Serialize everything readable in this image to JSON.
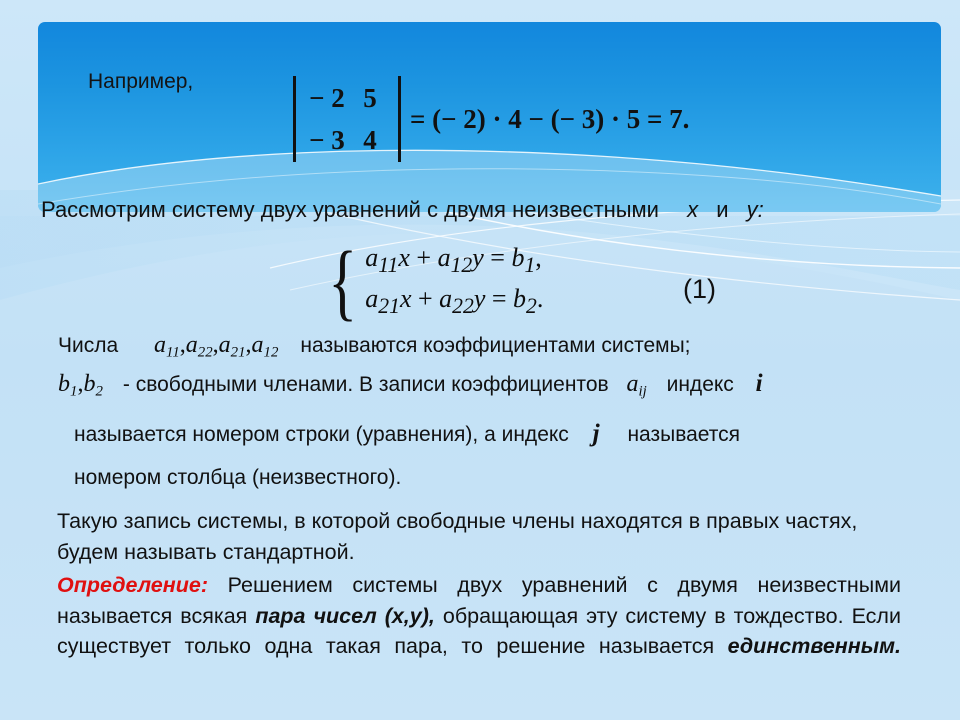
{
  "slide": {
    "background_color": "#c6e3f7",
    "panel_color": "#1d95e0",
    "accent_red": "#e01010"
  },
  "panel": {
    "label": "Например,",
    "determinant": {
      "matrix": [
        [
          "− 2",
          "5"
        ],
        [
          "− 3",
          "4"
        ]
      ],
      "rhs": "= (− 2) · 4 − (− 3) · 5 = 7."
    }
  },
  "body": {
    "consider_prefix": "Рассмотрим систему двух уравнений с  двумя неизвестными",
    "consider_x": "x",
    "consider_and": "и",
    "consider_y": "y:",
    "system": {
      "equation_1": {
        "a1": "a",
        "a1_sub": "11",
        "x": "x",
        "plus": "+",
        "a2": "a",
        "a2_sub": "12",
        "y": "y",
        "eq": "=",
        "b": "b",
        "b_sub": "1",
        "tail": ","
      },
      "equation_2": {
        "a1": "a",
        "a1_sub": "21",
        "x": "x",
        "plus": "+",
        "a2": "a",
        "a2_sub": "22",
        "y": "y",
        "eq": "=",
        "b": "b",
        "b_sub": "2",
        "tail": "."
      }
    },
    "equation_number": "(1)",
    "chisla_prefix": "Числа",
    "coefficients": "a₁₁ , a₂₂ , a₂₁ , a₁₂",
    "chisla_suffix": "называются коэффициентами системы;",
    "free_terms_symbols": "b₁ , b₂",
    "free_terms_text": "- свободными членами. В записи коэффициентов",
    "aij": "aᵢⱼ",
    "index_word": "индекс",
    "index_i": "i",
    "row_line": "называется номером строки (уравнения), а индекс",
    "index_j": "j",
    "row_line_tail": "называется",
    "column_line": "номером столбца (неизвестного).",
    "standard_paragraph": "Такую запись системы, в которой свободные члены находятся в правых частях, будем называть стандартной.",
    "definition_label": "Определение:",
    "definition_part1": " Решением системы двух уравнений с двумя неизвестными называется всякая ",
    "definition_bold1": "пара чисел (x,y),",
    "definition_part2": " обращающая эту систему в тождество. Если существует только одна такая пара, то решение называется ",
    "definition_bold2": "единственным."
  }
}
